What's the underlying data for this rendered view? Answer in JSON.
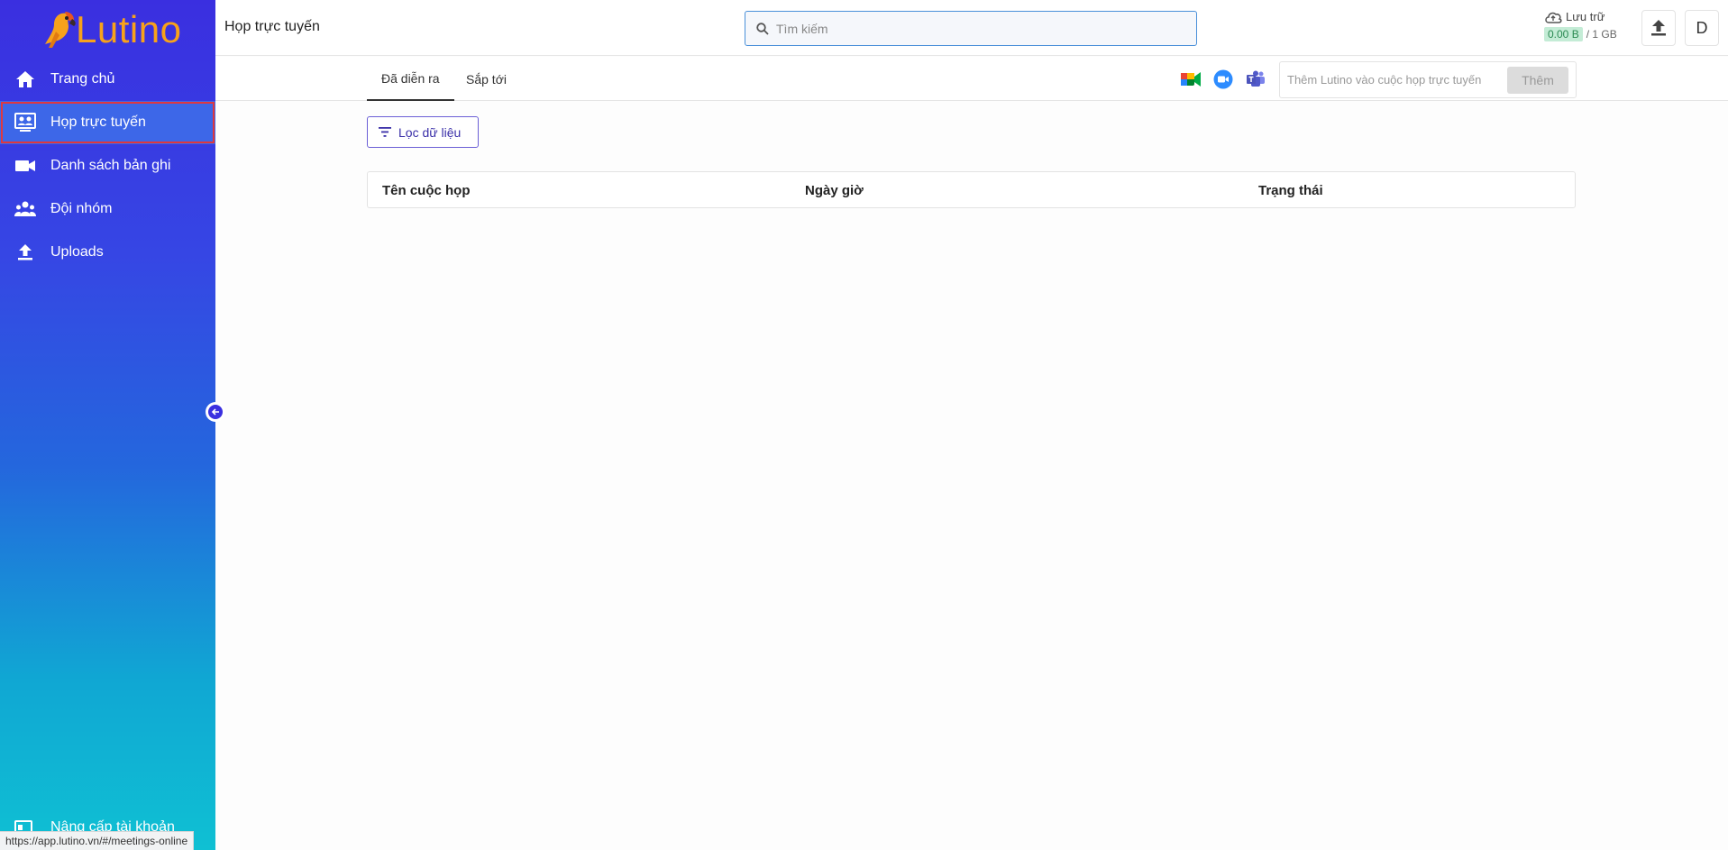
{
  "sidebar": {
    "logo_text": "Lutino",
    "items": [
      {
        "label": "Trang chủ",
        "icon": "home-icon"
      },
      {
        "label": "Họp trực tuyến",
        "icon": "meeting-icon",
        "active": true
      },
      {
        "label": "Danh sách bản ghi",
        "icon": "video-icon"
      },
      {
        "label": "Đội nhóm",
        "icon": "team-icon"
      },
      {
        "label": "Uploads",
        "icon": "upload-icon"
      }
    ],
    "upgrade_label": "Nâng cấp tài khoản"
  },
  "status_url": "https://app.lutino.vn/#/meetings-online",
  "header": {
    "title": "Họp trực tuyến",
    "search_placeholder": "Tìm kiếm",
    "storage_label": "Lưu trữ",
    "storage_used": "0.00 B",
    "storage_total": "/ 1 GB",
    "avatar_letter": "D"
  },
  "tabs": [
    {
      "label": "Đã diễn ra",
      "active": true
    },
    {
      "label": "Sắp tới",
      "active": false
    }
  ],
  "add_meeting": {
    "placeholder": "Thêm Lutino vào cuộc họp trực tuyến",
    "button_label": "Thêm"
  },
  "filter_label": "Lọc dữ liệu",
  "table": {
    "columns": [
      "Tên cuộc họp",
      "Ngày giờ",
      "Trạng thái"
    ],
    "rows": []
  },
  "colors": {
    "sidebar_top": "#3a2fe0",
    "sidebar_bottom": "#0fc0d3",
    "active_item": "#3d67e8",
    "logo": "#f7a21b",
    "accent": "#6b5fd6"
  }
}
